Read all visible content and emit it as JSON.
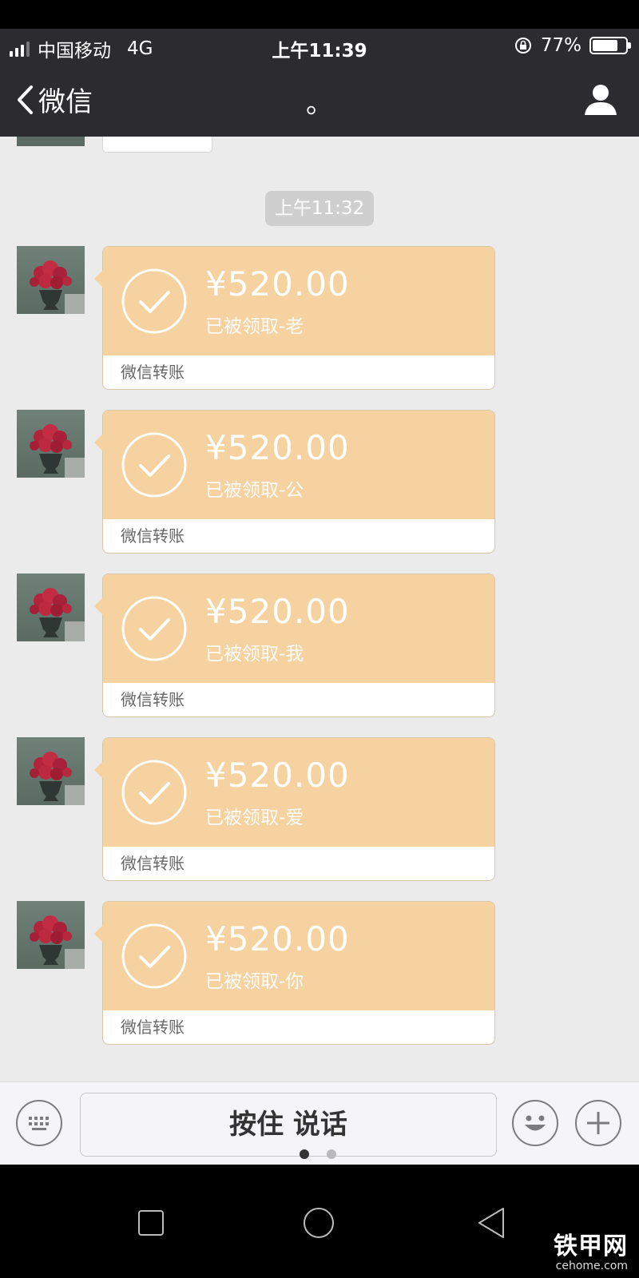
{
  "status_bar": {
    "carrier": "中国移动",
    "network": "4G",
    "time": "上午11:39",
    "battery_percent_label": "77%",
    "battery_level": 0.77
  },
  "nav": {
    "back_label": "微信",
    "title": "。"
  },
  "chat": {
    "timestamp": "上午11:32",
    "messages": [
      {
        "amount": "¥520.00",
        "status": "已被领取-老",
        "footer": "微信转账"
      },
      {
        "amount": "¥520.00",
        "status": "已被领取-公",
        "footer": "微信转账"
      },
      {
        "amount": "¥520.00",
        "status": "已被领取-我",
        "footer": "微信转账"
      },
      {
        "amount": "¥520.00",
        "status": "已被领取-爱",
        "footer": "微信转账"
      },
      {
        "amount": "¥520.00",
        "status": "已被领取-你",
        "footer": "微信转账"
      }
    ]
  },
  "input_bar": {
    "hold_to_talk": "按住 说话"
  },
  "watermark": {
    "brand": "铁甲网",
    "domain": "cehome.com"
  },
  "colors": {
    "transfer_bg": "#f5d29f",
    "chat_bg": "#ebebeb",
    "nav_bg": "#2c2c2e"
  }
}
